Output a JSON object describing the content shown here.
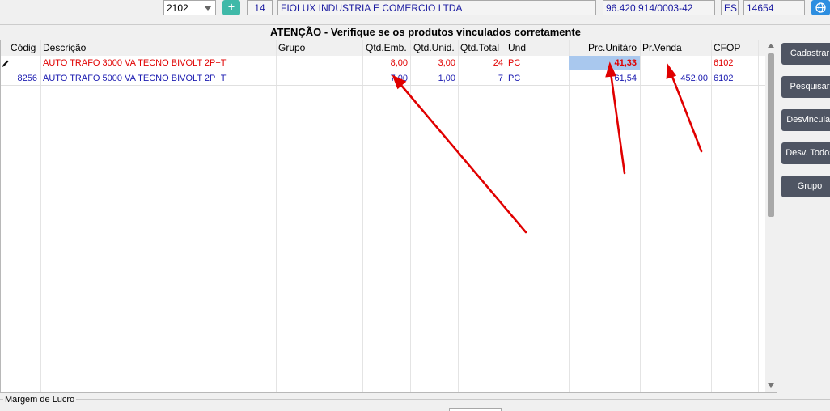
{
  "topbar": {
    "combo_value": "2102",
    "add_label": "+",
    "code": "14",
    "supplier_name": "FIOLUX INDUSTRIA E COMERCIO LTDA",
    "cnpj": "96.420.914/0003-42",
    "state": "ES",
    "number": "14654"
  },
  "header_title": "ATENÇÃO - Verifique se os produtos  vinculados corretamente",
  "grid": {
    "columns": [
      "Códig",
      "Descrição",
      "Grupo",
      "Qtd.Emb.",
      "Qtd.Unid.",
      "Qtd.Total",
      "Und",
      "Prc.Unitáro",
      "Pr.Venda",
      "CFOP"
    ],
    "rows": [
      {
        "codigo": "",
        "descricao": "AUTO TRAFO 3000 VA TECNO BIVOLT 2P+T",
        "grupo": "",
        "qtd_emb": "8,00",
        "qtd_unid": "3,00",
        "qtd_total": "24",
        "und": "PC",
        "prc_unitario": "41,33",
        "pr_venda": "",
        "cfop": "6102"
      },
      {
        "codigo": "8256",
        "descricao": "AUTO TRAFO 5000 VA TECNO BIVOLT 2P+T",
        "grupo": "",
        "qtd_emb": "7,00",
        "qtd_unid": "1,00",
        "qtd_total": "7",
        "und": "PC",
        "prc_unitario": "61,54",
        "pr_venda": "452,00",
        "cfop": "6102"
      }
    ]
  },
  "side_buttons": [
    "Cadastrar",
    "Pesquisar",
    "Desvincular",
    "Desv. Todos",
    "Grupo"
  ],
  "footer": {
    "label": "Margem de Lucro"
  },
  "colors": {
    "accent_green": "#3fb9a8",
    "button_dark": "#4f5563",
    "row_red": "#e00000",
    "row_blue": "#1a1ab0",
    "selection": "#a9c8ee",
    "annotation_arrow": "#e00000"
  }
}
